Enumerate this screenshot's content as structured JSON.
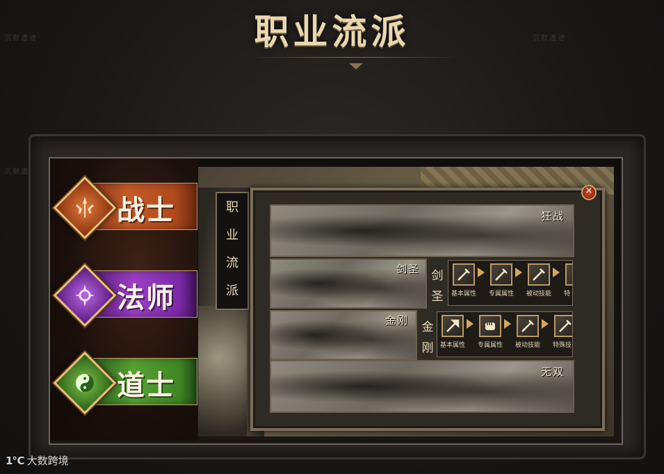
{
  "header": {
    "title": "职业流派"
  },
  "watermark": "沉默遗迹",
  "classes": [
    {
      "label": "战士",
      "icon": "warrior-emblem-icon"
    },
    {
      "label": "法师",
      "icon": "mage-emblem-icon"
    },
    {
      "label": "道士",
      "icon": "taoist-yinyang-icon"
    }
  ],
  "panel": {
    "vertical_title": [
      "职",
      "业",
      "流",
      "派"
    ],
    "close_label": "×",
    "schools": [
      {
        "label": "狂战"
      },
      {
        "label": "剑圣",
        "side": [
          "剑",
          "圣"
        ],
        "skills": [
          "基本属性",
          "专属属性",
          "被动技能",
          "特"
        ]
      },
      {
        "label": "金刚",
        "side": [
          "金",
          "刚"
        ],
        "skills": [
          "基本属性",
          "专属属性",
          "被动技能",
          "特殊技"
        ]
      },
      {
        "label": "无双"
      }
    ]
  },
  "footer": {
    "logo_mark": "1℃",
    "logo_text": "大数跨境"
  },
  "colors": {
    "warrior": "#c65a2a",
    "mage": "#9a3ec6",
    "taoist": "#56a232",
    "gold": "#c8a26a"
  }
}
